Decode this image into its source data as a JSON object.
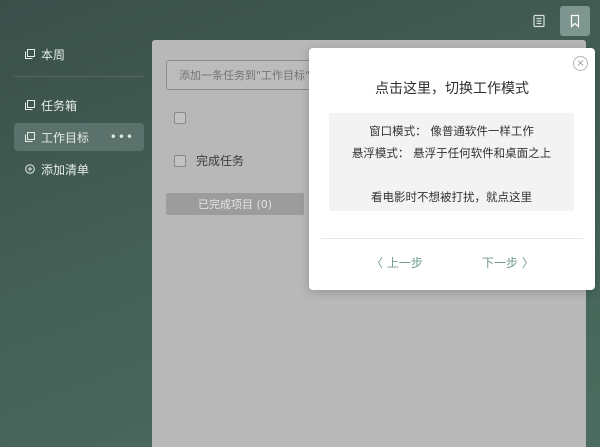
{
  "top_icons": [
    {
      "name": "book-icon",
      "active": false
    },
    {
      "name": "bookmark-icon",
      "active": true
    }
  ],
  "sidebar": {
    "items": [
      {
        "label": "本周",
        "icon": "copy-icon"
      },
      {
        "label": "任务箱",
        "icon": "copy-icon"
      },
      {
        "label": "工作目标",
        "icon": "copy-icon",
        "more": "•••",
        "active": true
      },
      {
        "label": "添加清单",
        "icon": "plus-circle-icon"
      }
    ]
  },
  "main": {
    "task_input_placeholder": "添加一条任务到\"工作目标\"",
    "completed_task_label": "完成任务",
    "completed_items_button": "已完成项目 (0)"
  },
  "popup": {
    "title": "点击这里，切换工作模式",
    "window_mode": "窗口模式：  像普通软件一样工作",
    "float_mode": "悬浮模式：  悬浮于任何软件和桌面之上",
    "movie_tip": "看电影时不想被打扰，就点这里",
    "prev_label": "〈 上一步",
    "next_label": "下一步 〉",
    "close_symbol": "×"
  },
  "colors": {
    "background": "#445f56",
    "sidebar_active": "#5b716b",
    "main_panel": "#b8b8b8",
    "popup_link": "#6f9a8a"
  }
}
